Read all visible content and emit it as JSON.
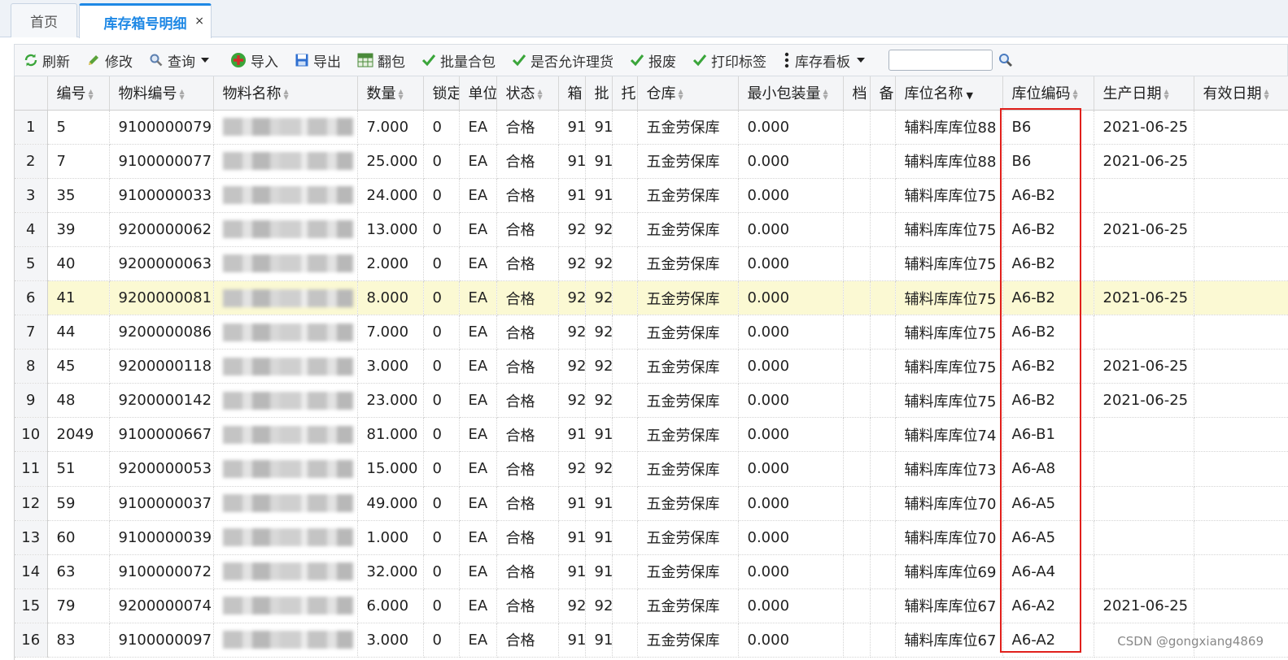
{
  "tabs": {
    "home": "首页",
    "active": "库存箱号明细",
    "close": "×"
  },
  "toolbar": {
    "refresh": "刷新",
    "edit": "修改",
    "query": "查询",
    "import": "导入",
    "export": "导出",
    "flip": "翻包",
    "merge": "批量合包",
    "allow": "是否允许理货",
    "scrap": "报废",
    "print": "打印标签",
    "board": "库存看板"
  },
  "columns": [
    "编号",
    "物料编号",
    "物料名称",
    "数量",
    "锁定",
    "单位",
    "状态",
    "箱",
    "批",
    "托",
    "仓库",
    "最小包装量",
    "档",
    "备",
    "库位名称",
    "库位编码",
    "生产日期",
    "有效日期"
  ],
  "rows": [
    {
      "rn": "1",
      "id": "5",
      "mat": "9100000079",
      "qty": "7.000",
      "lock": "0",
      "unit": "EA",
      "status": "合格",
      "box": "91",
      "batch": "91",
      "wh": "五金劳保库",
      "minpack": "0.000",
      "locname": "辅料库库位88",
      "loccode": "B6",
      "date": "2021-06-25"
    },
    {
      "rn": "2",
      "id": "7",
      "mat": "9100000077",
      "qty": "25.000",
      "lock": "0",
      "unit": "EA",
      "status": "合格",
      "box": "91",
      "batch": "91",
      "wh": "五金劳保库",
      "minpack": "0.000",
      "locname": "辅料库库位88",
      "loccode": "B6",
      "date": "2021-06-25"
    },
    {
      "rn": "3",
      "id": "35",
      "mat": "9100000033",
      "qty": "24.000",
      "lock": "0",
      "unit": "EA",
      "status": "合格",
      "box": "91",
      "batch": "91",
      "wh": "五金劳保库",
      "minpack": "0.000",
      "locname": "辅料库库位75",
      "loccode": "A6-B2",
      "date": ""
    },
    {
      "rn": "4",
      "id": "39",
      "mat": "9200000062",
      "qty": "13.000",
      "lock": "0",
      "unit": "EA",
      "status": "合格",
      "box": "92",
      "batch": "92",
      "wh": "五金劳保库",
      "minpack": "0.000",
      "locname": "辅料库库位75",
      "loccode": "A6-B2",
      "date": "2021-06-25"
    },
    {
      "rn": "5",
      "id": "40",
      "mat": "9200000063",
      "qty": "2.000",
      "lock": "0",
      "unit": "EA",
      "status": "合格",
      "box": "92",
      "batch": "92",
      "wh": "五金劳保库",
      "minpack": "0.000",
      "locname": "辅料库库位75",
      "loccode": "A6-B2",
      "date": ""
    },
    {
      "rn": "6",
      "id": "41",
      "mat": "9200000081",
      "qty": "8.000",
      "lock": "0",
      "unit": "EA",
      "status": "合格",
      "box": "92",
      "batch": "92",
      "wh": "五金劳保库",
      "minpack": "0.000",
      "locname": "辅料库库位75",
      "loccode": "A6-B2",
      "date": "2021-06-25",
      "highlight": true
    },
    {
      "rn": "7",
      "id": "44",
      "mat": "9200000086",
      "qty": "7.000",
      "lock": "0",
      "unit": "EA",
      "status": "合格",
      "box": "92",
      "batch": "92",
      "wh": "五金劳保库",
      "minpack": "0.000",
      "locname": "辅料库库位75",
      "loccode": "A6-B2",
      "date": ""
    },
    {
      "rn": "8",
      "id": "45",
      "mat": "9200000118",
      "qty": "3.000",
      "lock": "0",
      "unit": "EA",
      "status": "合格",
      "box": "92",
      "batch": "92",
      "wh": "五金劳保库",
      "minpack": "0.000",
      "locname": "辅料库库位75",
      "loccode": "A6-B2",
      "date": "2021-06-25"
    },
    {
      "rn": "9",
      "id": "48",
      "mat": "9200000142",
      "qty": "23.000",
      "lock": "0",
      "unit": "EA",
      "status": "合格",
      "box": "92",
      "batch": "92",
      "wh": "五金劳保库",
      "minpack": "0.000",
      "locname": "辅料库库位75",
      "loccode": "A6-B2",
      "date": "2021-06-25"
    },
    {
      "rn": "10",
      "id": "2049",
      "mat": "9100000667",
      "qty": "81.000",
      "lock": "0",
      "unit": "EA",
      "status": "合格",
      "box": "91",
      "batch": "91",
      "wh": "五金劳保库",
      "minpack": "0.000",
      "locname": "辅料库库位74",
      "loccode": "A6-B1",
      "date": ""
    },
    {
      "rn": "11",
      "id": "51",
      "mat": "9200000053",
      "qty": "15.000",
      "lock": "0",
      "unit": "EA",
      "status": "合格",
      "box": "92",
      "batch": "92",
      "wh": "五金劳保库",
      "minpack": "0.000",
      "locname": "辅料库库位73",
      "loccode": "A6-A8",
      "date": ""
    },
    {
      "rn": "12",
      "id": "59",
      "mat": "9100000037",
      "qty": "49.000",
      "lock": "0",
      "unit": "EA",
      "status": "合格",
      "box": "91",
      "batch": "91",
      "wh": "五金劳保库",
      "minpack": "0.000",
      "locname": "辅料库库位70",
      "loccode": "A6-A5",
      "date": ""
    },
    {
      "rn": "13",
      "id": "60",
      "mat": "9100000039",
      "qty": "1.000",
      "lock": "0",
      "unit": "EA",
      "status": "合格",
      "box": "91",
      "batch": "91",
      "wh": "五金劳保库",
      "minpack": "0.000",
      "locname": "辅料库库位70",
      "loccode": "A6-A5",
      "date": ""
    },
    {
      "rn": "14",
      "id": "63",
      "mat": "9100000072",
      "qty": "32.000",
      "lock": "0",
      "unit": "EA",
      "status": "合格",
      "box": "91",
      "batch": "91",
      "wh": "五金劳保库",
      "minpack": "0.000",
      "locname": "辅料库库位69",
      "loccode": "A6-A4",
      "date": ""
    },
    {
      "rn": "15",
      "id": "79",
      "mat": "9200000074",
      "qty": "6.000",
      "lock": "0",
      "unit": "EA",
      "status": "合格",
      "box": "92",
      "batch": "92",
      "wh": "五金劳保库",
      "minpack": "0.000",
      "locname": "辅料库库位67",
      "loccode": "A6-A2",
      "date": "2021-06-25"
    },
    {
      "rn": "16",
      "id": "83",
      "mat": "9100000097",
      "qty": "3.000",
      "lock": "0",
      "unit": "EA",
      "status": "合格",
      "box": "91",
      "batch": "91",
      "wh": "五金劳保库",
      "minpack": "0.000",
      "locname": "辅料库库位67",
      "loccode": "A6-A2",
      "date": ""
    }
  ],
  "watermark": "CSDN @gongxiang4869",
  "colors": {
    "accent": "#1e88e5",
    "highlight": "#fbf9d3",
    "annotation": "#e0201c",
    "icon_green": "#3aa53a"
  }
}
